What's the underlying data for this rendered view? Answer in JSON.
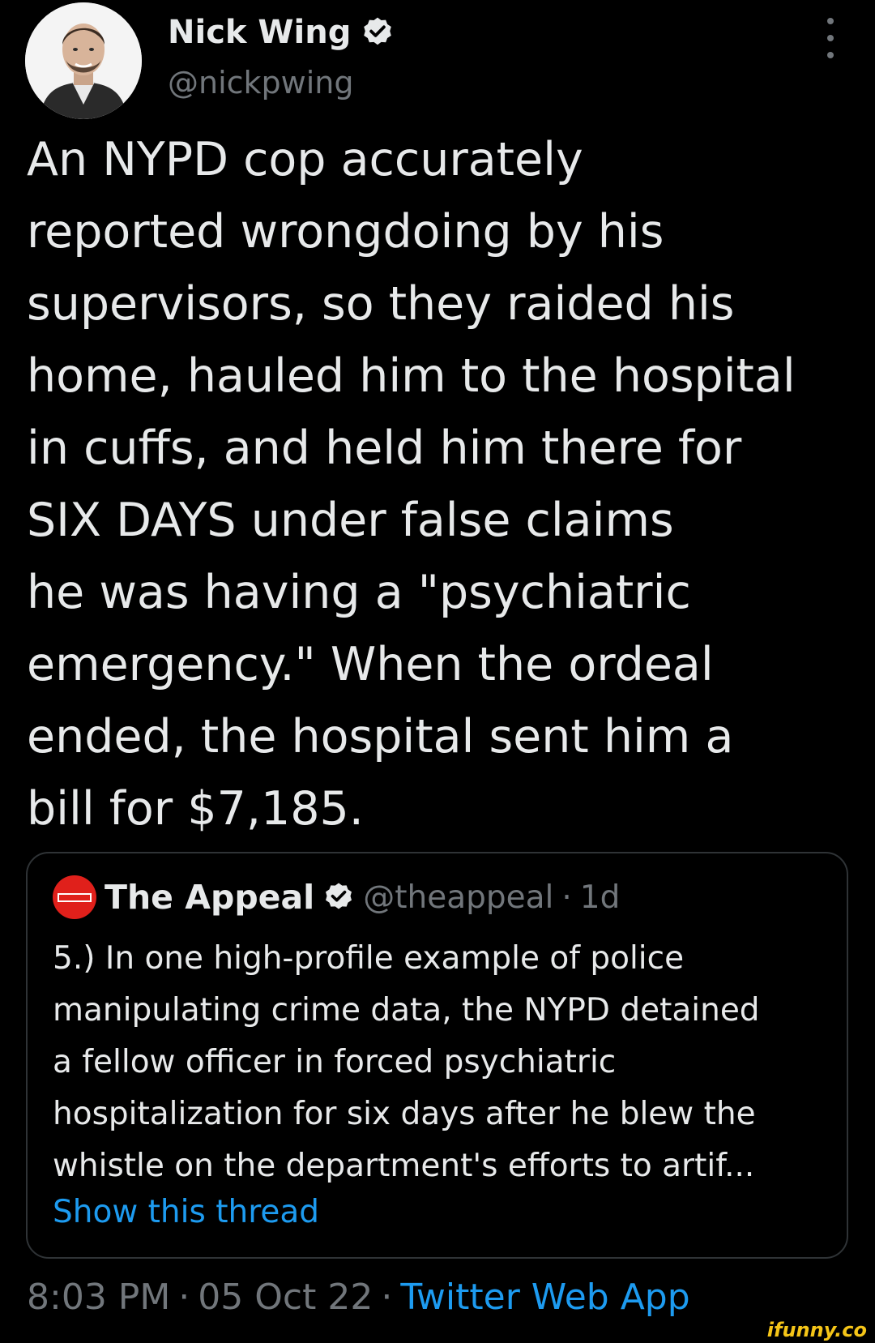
{
  "tweet": {
    "author_name": "Nick Wing",
    "author_handle": "@nickpwing",
    "text": "An NYPD cop accurately\nreported wrongdoing by his\nsupervisors, so they raided his\nhome, hauled him to the hospital\nin cuffs, and held him there for\nSIX DAYS under false claims\nhe was having a \"psychiatric\nemergency.\" When the ordeal\nended, the hospital sent him a\nbill for $7,185.",
    "more_icon": "more-vertical-icon",
    "verified_icon": "verified-badge-icon"
  },
  "quote": {
    "author_name": "The Appeal",
    "author_handle": "@theappeal",
    "separator": "·",
    "age": "1d",
    "logo_text": "THE APPEAL",
    "text": "5.) In one high-profile example of police\nmanipulating crime data, the NYPD detained\na fellow officer in forced psychiatric\nhospitalization for six days after he blew the\nwhistle on the department's efforts to artif...",
    "show_thread": "Show this thread"
  },
  "meta": {
    "time": "8:03 PM",
    "sep1": "·",
    "date": "05 Oct 22",
    "sep2": "·",
    "source": "Twitter Web App"
  },
  "watermark": "ifunny.co",
  "colors": {
    "background": "#000000",
    "text": "#e7e9ea",
    "secondary": "#71767b",
    "link": "#1d9bf0",
    "verified": "#e7e9ea",
    "appeal_logo": "#e0201b"
  }
}
